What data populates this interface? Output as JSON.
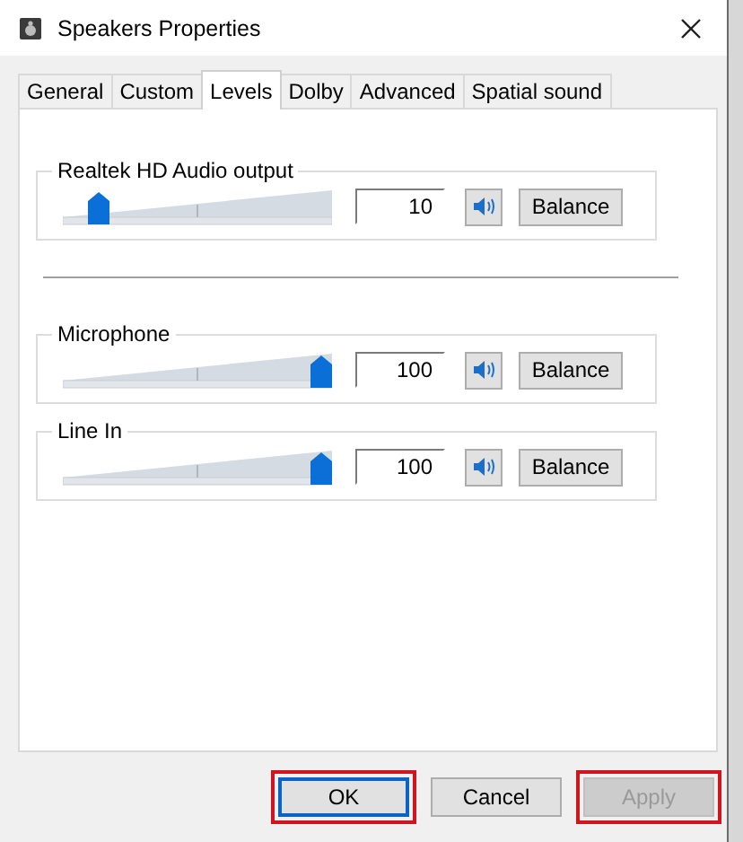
{
  "window": {
    "title": "Speakers Properties"
  },
  "tabs": [
    {
      "label": "General",
      "selected": false
    },
    {
      "label": "Custom",
      "selected": false
    },
    {
      "label": "Levels",
      "selected": true
    },
    {
      "label": "Dolby",
      "selected": false
    },
    {
      "label": "Advanced",
      "selected": false
    },
    {
      "label": "Spatial sound",
      "selected": false
    }
  ],
  "groups": [
    {
      "label": "Realtek HD Audio output",
      "level": 0.1,
      "value": "10",
      "muted": false,
      "balance": "Balance",
      "divider_after": true
    },
    {
      "label": "Microphone",
      "level": 1,
      "value": "100",
      "muted": false,
      "balance": "Balance",
      "divider_after": false
    },
    {
      "label": "Line In",
      "level": 1,
      "value": "100",
      "muted": false,
      "balance": "Balance",
      "divider_after": false
    }
  ],
  "buttons": [
    {
      "label": "OK",
      "default": true,
      "disabled": false,
      "highlighted": true
    },
    {
      "label": "Cancel",
      "default": false,
      "disabled": false,
      "highlighted": false
    },
    {
      "label": "Apply",
      "default": false,
      "disabled": true,
      "highlighted": true
    }
  ]
}
